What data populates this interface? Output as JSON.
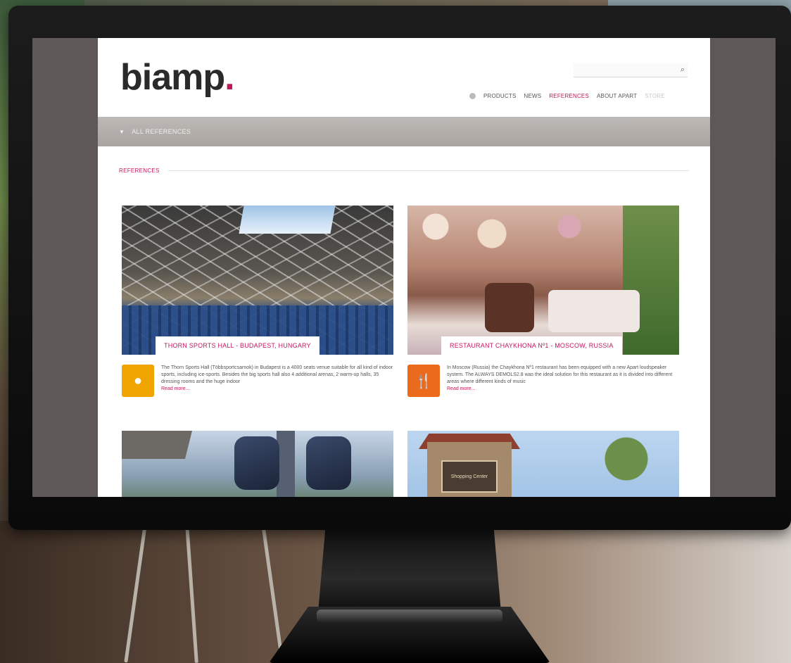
{
  "site": {
    "logo_text": "biamp",
    "logo_dot": ".",
    "search_placeholder": "",
    "nav": {
      "home_icon": "home-icon",
      "items": [
        "PRODUCTS",
        "NEWS",
        "REFERENCES",
        "ABOUT APART",
        "STORE"
      ],
      "active": "REFERENCES"
    },
    "filter_label": "ALL REFERENCES",
    "section_title": "REFERENCES"
  },
  "cards": [
    {
      "caption": "THORN SPORTS HALL - BUDAPEST, HUNGARY",
      "icon": "sports-icon",
      "icon_color": "#f0a400",
      "text": "The Thorn Sports Hall (Többsportcsarnok) in Budapest is a 4000 seats venue suitable for all kind of indoor sports, including ice-sports. Besides the big sports hall also 4 additional arenas, 2 warm-up halls, 35 dressing rooms and the huge indoor",
      "more": "Read more..."
    },
    {
      "caption": "RESTAURANT CHAYKHONA Nº1 - MOSCOW, RUSSIA",
      "icon": "restaurant-icon",
      "icon_color": "#ec6a1c",
      "text": "In Moscow (Russia) the Chaykhona Nº1 restaurant has been equipped with a new Apart loudspeaker system. The ALWAYS DEMOLS2.8 was the ideal solution for this restaurant as it is divided into different areas where different kinds of music",
      "more": "Read more..."
    },
    {
      "caption": "",
      "icon": "",
      "text": "",
      "more": ""
    },
    {
      "caption": "",
      "icon": "",
      "text": "",
      "more": "",
      "sign_text": "Shopping Center"
    }
  ],
  "colors": {
    "accent": "#c2185b",
    "header_bar": "#b3aeaa"
  }
}
